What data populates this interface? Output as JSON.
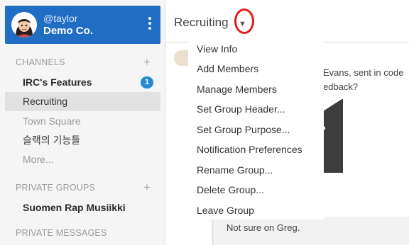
{
  "team": {
    "username": "@taylor",
    "name": "Demo Co."
  },
  "sidebar": {
    "channels_label": "CHANNELS",
    "channels": [
      {
        "label": "IRC's Features",
        "badge": "1"
      },
      {
        "label": "Recruiting"
      },
      {
        "label": "Town Square"
      },
      {
        "label": "슬랙의 기능들"
      },
      {
        "label": "More..."
      }
    ],
    "private_groups_label": "PRIVATE GROUPS",
    "private_groups": [
      {
        "label": "Suomen Rap Musiikki"
      }
    ],
    "private_messages_label": "PRIVATE MESSAGES"
  },
  "channel": {
    "name": "Recruiting"
  },
  "menu": {
    "items": [
      "View Info",
      "Add Members",
      "Manage Members",
      "Set Group Header...",
      "Set Group Purpose...",
      "Notification Preferences",
      "Rename Group...",
      "Delete Group...",
      "Leave Group"
    ]
  },
  "posts": {
    "line1": "Evans, sent in code",
    "line2": "edback?",
    "reply": "Not sure on Greg."
  },
  "colors": {
    "team_header": "#1f6ec4",
    "badge": "#2389d7",
    "highlight_circle": "#e41b1b"
  }
}
